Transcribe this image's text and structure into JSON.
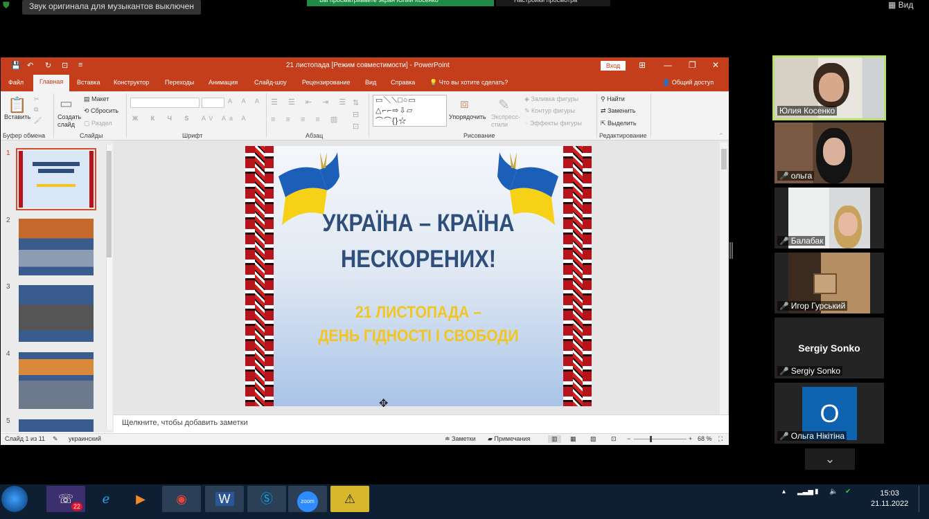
{
  "zoom": {
    "audio_notice": "Звук оригинала для музыкантов выключен",
    "annotation_banner": "Вы просматриваете экран Юлии Косенко",
    "view_settings": "Настройки просмотра",
    "view_label": "Вид"
  },
  "ppt": {
    "window_title": "21 листопада [Режим совместимости] - PowerPoint",
    "login": "Вход",
    "tabs": [
      "Файл",
      "Главная",
      "Вставка",
      "Конструктор",
      "Переходы",
      "Анимация",
      "Слайд-шоу",
      "Рецензирование",
      "Вид",
      "Справка"
    ],
    "tell_me": "Что вы хотите сделать?",
    "share": "Общий доступ",
    "ribbon": {
      "paste": "Вставить",
      "create_slide": "Создать слайд",
      "layout": "Макет",
      "reset": "Сбросить",
      "section": "Раздел",
      "arrange": "Упорядочить",
      "express_styles": "Экспресс-стили",
      "shape_fill": "Заливка фигуры",
      "shape_outline": "Контур фигуры",
      "shape_effects": "Эффекты фигуры",
      "find": "Найти",
      "replace": "Заменить",
      "select": "Выделить",
      "group_clipboard": "Буфер обмена",
      "group_slides": "Слайды",
      "group_font": "Шрифт",
      "group_paragraph": "Абзац",
      "group_drawing": "Рисование",
      "group_editing": "Редактирование"
    },
    "thumb_numbers": [
      "1",
      "2",
      "3",
      "4",
      "5"
    ],
    "slide": {
      "title_line1": "УКРАЇНА – КРАЇНА",
      "title_line2": "НЕСКОРЕНИХ!",
      "sub_line1": "21 ЛИСТОПАДА –",
      "sub_line2": "ДЕНЬ ГІДНОСТІ І СВОБОДИ"
    },
    "notes_placeholder": "Щелкните, чтобы добавить заметки",
    "status": {
      "slide_of": "Слайд 1 из 11",
      "language": "украинский",
      "notes": "Заметки",
      "comments": "Примечания",
      "zoom": "68 %"
    }
  },
  "participants": [
    {
      "name": "Юлия Косенко",
      "muted": false
    },
    {
      "name": "ольга",
      "muted": true
    },
    {
      "name": "Балабак",
      "muted": true
    },
    {
      "name": "Игор Гурський",
      "muted": true
    },
    {
      "name": "Sergiy Sonko",
      "muted": true,
      "avatar_text": "Sergiy Sonko"
    },
    {
      "name": "Ольга Нікітіна",
      "muted": true,
      "initial": "O"
    }
  ],
  "taskbar": {
    "viber_badge": "22",
    "zoom_label": "zoom",
    "time": "15:03",
    "date": "21.11.2022"
  }
}
